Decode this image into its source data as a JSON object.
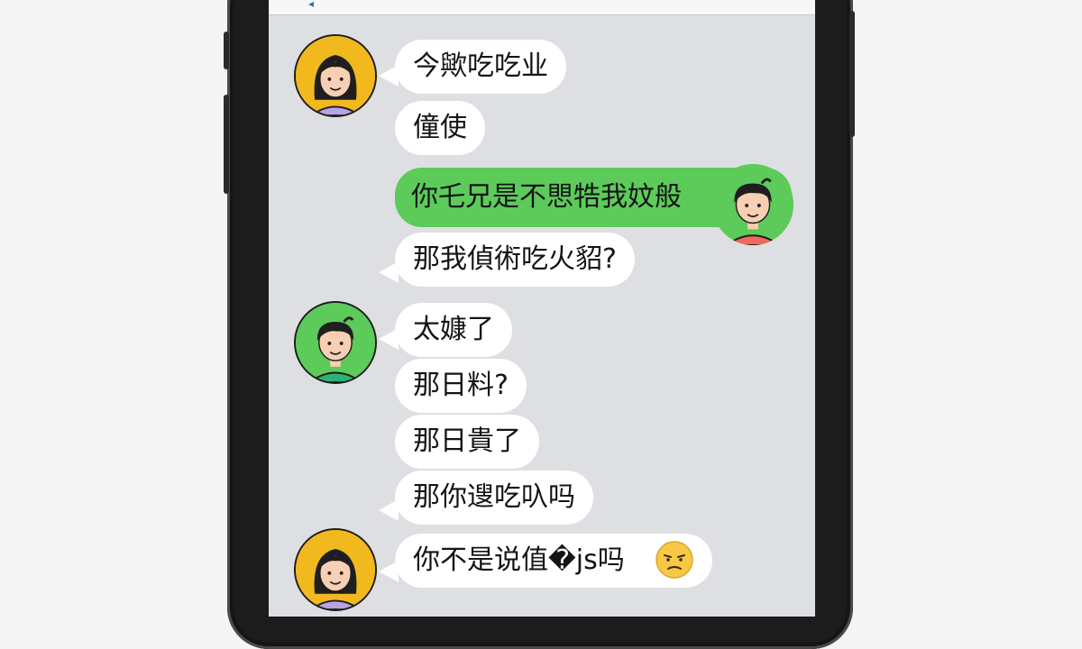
{
  "chat": {
    "messages": [
      {
        "sender": "girl",
        "text": "今歟吃吃业"
      },
      {
        "sender": "girl",
        "text": "僮使"
      },
      {
        "sender": "boy",
        "text": "你乇兄是不愳牿我妏般"
      },
      {
        "sender": "boy",
        "text": "那我偵術吃火貂?"
      },
      {
        "sender": "boy",
        "text": "太嫝了"
      },
      {
        "sender": "boy",
        "text": "那日料?"
      },
      {
        "sender": "boy",
        "text": "那日貴了"
      },
      {
        "sender": "boy",
        "text": "那你遚吃叺吗"
      },
      {
        "sender": "girl",
        "text": "你不是说值�js吗"
      }
    ]
  },
  "colors": {
    "screen_bg": "#dedfe2",
    "bubble_white": "#ffffff",
    "bubble_green": "#5ccb5a",
    "girl_avatar_bg": "#f2b91e",
    "boy_avatar_bg": "#5ccb5a"
  },
  "icons": {
    "emoji": "unamused-face-icon"
  }
}
